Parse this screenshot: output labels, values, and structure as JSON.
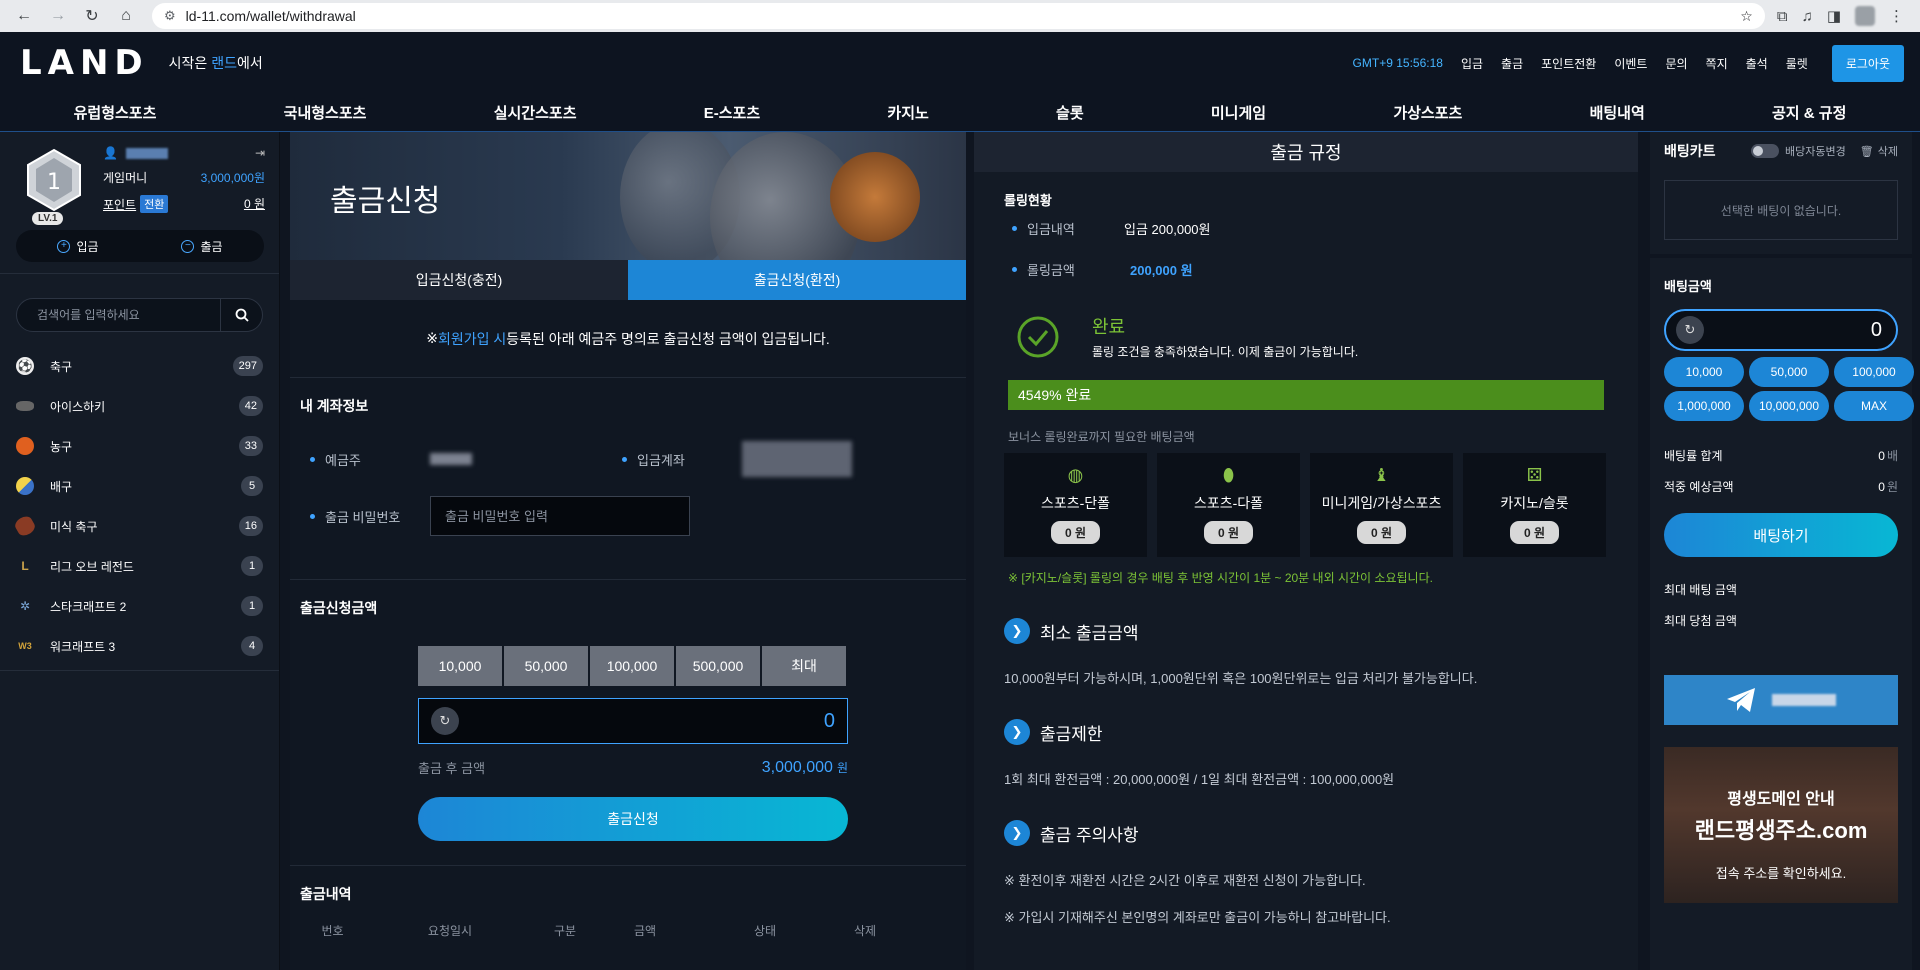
{
  "browser": {
    "url": "ld-11.com/wallet/withdrawal"
  },
  "header": {
    "logo": "LAND",
    "tagline_pre": "시작은 ",
    "tagline_hl": "랜드",
    "tagline_post": "에서",
    "clock": "GMT+9 15:56:18",
    "links": [
      "입금",
      "출금",
      "포인트전환",
      "이벤트",
      "문의",
      "쪽지",
      "출석",
      "룰렛"
    ],
    "logout": "로그아웃"
  },
  "nav": [
    "유럽형스포츠",
    "국내형스포츠",
    "실시간스포츠",
    "E-스포츠",
    "카지노",
    "슬롯",
    "미니게임",
    "가상스포츠",
    "배팅내역",
    "공지 & 규정"
  ],
  "profile": {
    "level_num": "1",
    "level": "LV.1",
    "game_money_label": "게임머니",
    "game_money": "3,000,000원",
    "point_label": "포인트",
    "convert": "전환",
    "point": "0 원",
    "deposit": "입금",
    "withdraw": "출금"
  },
  "search": {
    "placeholder": "검색어를 입력하세요"
  },
  "sports": [
    {
      "name": "축구",
      "count": "297",
      "icon": "soccer-ball-icon"
    },
    {
      "name": "아이스하키",
      "count": "42",
      "icon": "hockey-puck-icon"
    },
    {
      "name": "농구",
      "count": "33",
      "icon": "basketball-icon"
    },
    {
      "name": "배구",
      "count": "5",
      "icon": "volleyball-icon"
    },
    {
      "name": "미식 축구",
      "count": "16",
      "icon": "american-football-icon"
    },
    {
      "name": "리그 오브 레전드",
      "count": "1",
      "icon": "lol-icon"
    },
    {
      "name": "스타크래프트 2",
      "count": "1",
      "icon": "starcraft-icon"
    },
    {
      "name": "워크래프트 3",
      "count": "4",
      "icon": "warcraft-icon"
    }
  ],
  "withdraw": {
    "banner_title": "출금신청",
    "tab_deposit": "입금신청(충전)",
    "tab_withdraw": "출금신청(환전)",
    "notice_pre": "※ ",
    "notice_hl": "회원가입 시",
    "notice_post": " 등록된 아래 예금주 명의로 출금신청 금액이 입금됩니다.",
    "account_title": "내 계좌정보",
    "holder_label": "예금주",
    "account_label": "입금계좌",
    "pw_label": "출금 비밀번호",
    "pw_placeholder": "출금 비밀번호 입력",
    "amount_title": "출금신청금액",
    "amount_buttons": [
      "10,000",
      "50,000",
      "100,000",
      "500,000",
      "최대"
    ],
    "amount_value": "0",
    "after_label": "출금 후 금액",
    "after_value": "3,000,000",
    "after_unit": "원",
    "submit": "출금신청",
    "history_title": "출금내역",
    "history_columns": [
      "번호",
      "요청일시",
      "구분",
      "금액",
      "상태",
      "삭제"
    ]
  },
  "rules": {
    "title": "출금 규정",
    "rolling_title": "롤링현황",
    "deposit_label": "입금내역",
    "deposit_value": "입금 200,000원",
    "rolling_label": "롤링금액",
    "rolling_value": "200,000 원",
    "done_title": "완료",
    "done_desc": "롤링 조건을 충족하였습니다. 이제 출금이 가능합니다.",
    "progress_text": "4549% 완료",
    "progress_fraction": 1.0,
    "bonus_label": "보너스 롤링완료까지 필요한 배팅금액",
    "categories": [
      {
        "label": "스포츠-단폴",
        "value": "0 원",
        "icon": "volleyball-icon"
      },
      {
        "label": "스포츠-다폴",
        "value": "0 원",
        "icon": "football-icon"
      },
      {
        "label": "미니게임/가상스포츠",
        "value": "0 원",
        "icon": "chess-piece-icon"
      },
      {
        "label": "카지노/슬롯",
        "value": "0 원",
        "icon": "dice-icon"
      }
    ],
    "casino_note": "※ [카지노/슬롯] 롤링의 경우 배팅 후 반영 시간이 1분 ~ 20분 내외 시간이 소요됩니다.",
    "sections": [
      {
        "title": "최소 출금금액",
        "lines": [
          "10,000원부터 가능하시며, 1,000원단위 혹은 100원단위로는 입금 처리가 불가능합니다."
        ]
      },
      {
        "title": "출금제한",
        "lines": [
          "1회 최대 환전금액 : 20,000,000원 / 1일 최대 환전금액 : 100,000,000원"
        ]
      },
      {
        "title": "출금 주의사항",
        "lines": [
          "※ 환전이후 재환전 시간은 2시간 이후로 재환전 신청이 가능합니다.",
          "※ 가입시 기재해주신 본인명의 계좌로만 출금이 가능하니 참고바랍니다."
        ]
      }
    ]
  },
  "betslip": {
    "title": "배팅카트",
    "auto_label": "배당자동변경",
    "delete": "삭제",
    "empty": "선택한 배팅이 없습니다.",
    "amount_label": "배팅금액",
    "amount_value": "0",
    "quick": [
      "10,000",
      "50,000",
      "100,000",
      "1,000,000",
      "10,000,000",
      "MAX"
    ],
    "odds_label": "배팅률 합계",
    "odds_value": "0",
    "odds_unit": "배",
    "win_label": "적중 예상금액",
    "win_value": "0",
    "win_unit": "원",
    "bet_button": "배팅하기",
    "max_bet": "최대 배팅 금액",
    "max_win": "최대 당첨 금액",
    "domain_title": "평생도메인 안내",
    "domain_name": "랜드평생주소.com",
    "domain_desc": "접속 주소를 확인하세요."
  }
}
